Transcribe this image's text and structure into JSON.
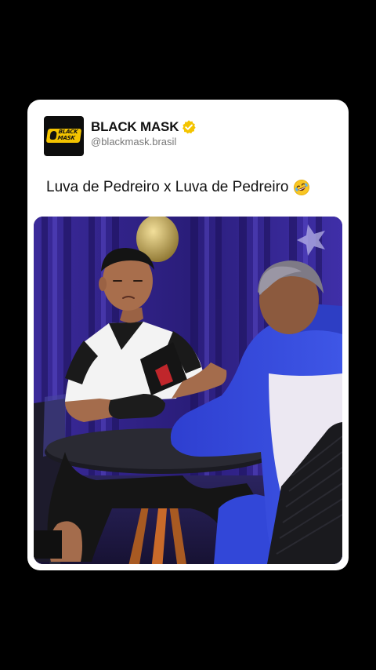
{
  "post": {
    "account_name": "BLACK MASK",
    "handle": "@blackmask.brasil",
    "logo_text": "BLACK\nMASK",
    "text": "Luva de Pedreiro x Luva de Pedreiro",
    "emoji": "rolling-on-the-floor-laughing-emoji",
    "verified_icon": "verified-badge-icon"
  },
  "colors": {
    "background": "#000000",
    "card": "#ffffff",
    "verified": "#f4c400",
    "logo": "#f4c400"
  },
  "media": {
    "type": "video-still"
  }
}
